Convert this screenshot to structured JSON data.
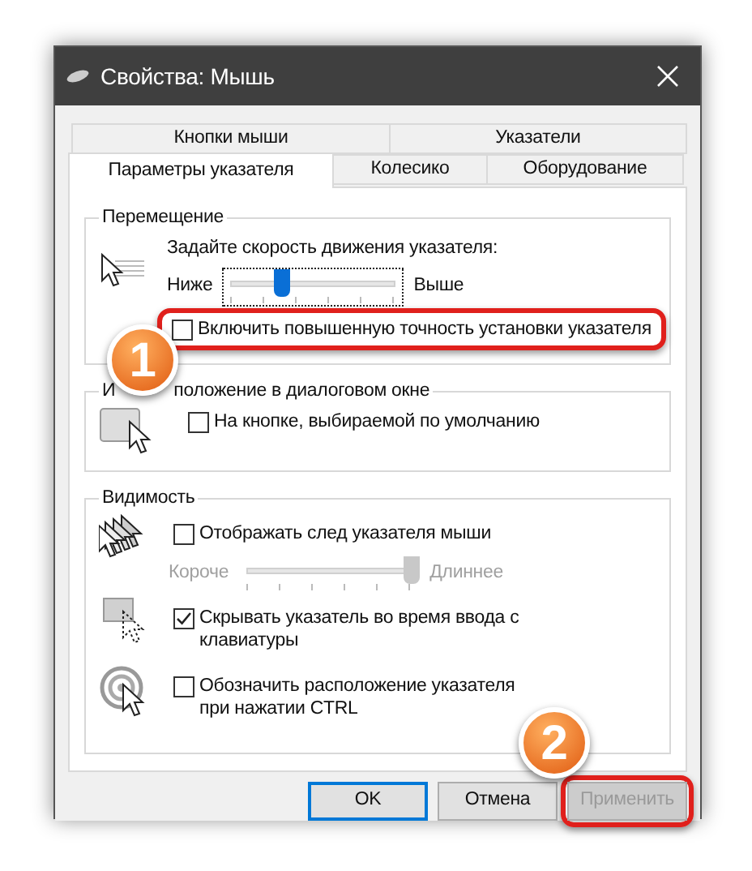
{
  "window": {
    "title": "Свойства: Мышь"
  },
  "tab_rows": [
    {
      "tabs": [
        {
          "label": "Кнопки мыши",
          "selected": false
        },
        {
          "label": "Указатели",
          "selected": false
        }
      ]
    },
    {
      "tabs": [
        {
          "label": "Параметры указателя",
          "selected": true
        },
        {
          "label": "Колесико",
          "selected": false
        },
        {
          "label": "Оборудование",
          "selected": false
        }
      ]
    }
  ],
  "motion": {
    "title": "Перемещение",
    "prompt": "Задайте скорость движения указателя:",
    "slider": {
      "min_label": "Ниже",
      "max_label": "Выше",
      "level": 0.31,
      "disabled": false
    },
    "checkbox": {
      "label": "Включить повышенную точность установки указателя",
      "checked": false,
      "highlighted": true
    }
  },
  "snap": {
    "title_parts": [
      "И",
      "положение в диалоговом окне"
    ],
    "checkbox": {
      "label": "На кнопке, выбираемой по умолчанию",
      "checked": false
    }
  },
  "visibility": {
    "title": "Видимость",
    "options": [
      {
        "kind": "trail",
        "label": "Отображать след указателя мыши",
        "checked": false,
        "slider": {
          "min_label": "Короче",
          "max_label": "Длиннее",
          "level": 1,
          "disabled": true
        }
      },
      {
        "kind": "hide",
        "label": "Скрывать указатель во время ввода с клавиатуры",
        "checked": true
      },
      {
        "kind": "locate",
        "label": "Обозначить расположение указателя при нажатии CTRL",
        "checked": false
      }
    ]
  },
  "buttons": [
    {
      "label": "OK",
      "default": true,
      "disabled": false,
      "highlighted": false
    },
    {
      "label": "Отмена",
      "default": false,
      "disabled": false,
      "highlighted": false
    },
    {
      "label": "Применить",
      "default": false,
      "disabled": true,
      "highlighted": true
    }
  ],
  "callouts": [
    {
      "label": "1"
    },
    {
      "label": "2"
    }
  ]
}
